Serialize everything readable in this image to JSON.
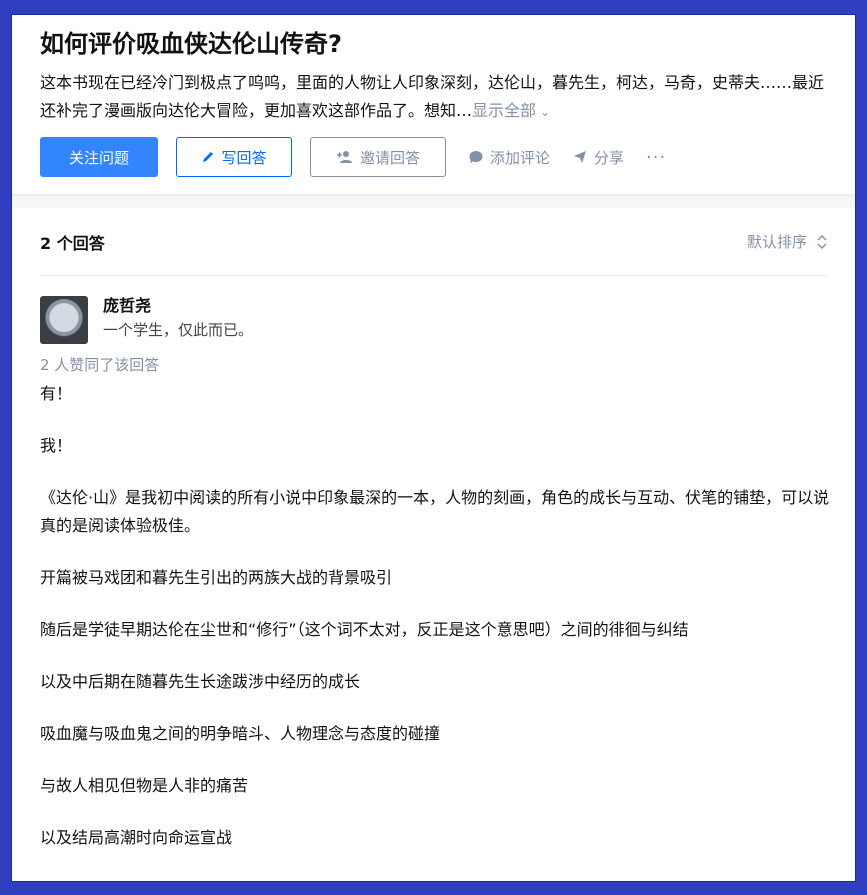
{
  "question": {
    "title": "如何评价吸血侠达伦山传奇?",
    "detail": "这本书现在已经冷门到极点了呜呜，里面的人物让人印象深刻，达伦山，暮先生，柯达，马奇，史蒂夫……最近还补完了漫画版向达伦大冒险，更加喜欢这部作品了。想知…",
    "show_all": "显示全部"
  },
  "actions": {
    "follow": "关注问题",
    "write": "写回答",
    "invite": "邀请回答",
    "comment": "添加评论",
    "share": "分享",
    "more": "···"
  },
  "answers": {
    "count_label": "2 个回答",
    "sort_label": "默认排序"
  },
  "answer": {
    "author_name": "庞哲尧",
    "author_bio": "一个学生，仅此而已。",
    "votes": "2 人赞同了该回答",
    "paragraphs": [
      "有！",
      "我！",
      "《达伦·山》是我初中阅读的所有小说中印象最深的一本，人物的刻画，角色的成长与互动、伏笔的铺垫，可以说真的是阅读体验极佳。",
      "开篇被马戏团和暮先生引出的两族大战的背景吸引",
      "随后是学徒早期达伦在尘世和“修行”（这个词不太对，反正是这个意思吧）之间的徘徊与纠结",
      "以及中后期在随暮先生长途跋涉中经历的成长",
      "吸血魔与吸血鬼之间的明争暗斗、人物理念与态度的碰撞",
      "与故人相见但物是人非的痛苦",
      "以及结局高潮时向命运宣战"
    ]
  },
  "colors": {
    "accent": "#0066ff",
    "muted": "#8590a6",
    "frame": "#2f3fc0"
  }
}
